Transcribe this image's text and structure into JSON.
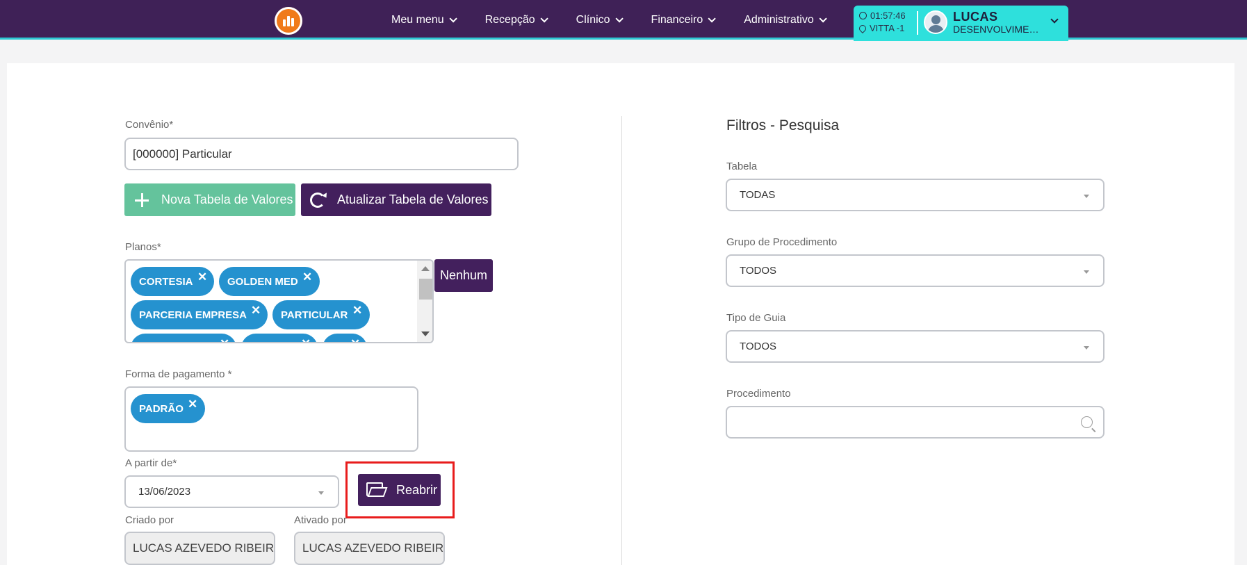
{
  "nav": {
    "items": [
      {
        "label": "Meu menu"
      },
      {
        "label": "Recepção"
      },
      {
        "label": "Clínico"
      },
      {
        "label": "Financeiro"
      },
      {
        "label": "Administrativo"
      }
    ]
  },
  "user": {
    "time": "01:57:46",
    "location": "VITTA -1",
    "name": "LUCAS",
    "role": "DESENVOLVIMENTO"
  },
  "form": {
    "convenio_label": "Convênio*",
    "convenio_value": "[000000] Particular",
    "new_table_button": "Nova Tabela de Valores",
    "update_table_button": "Atualizar Tabela de Valores",
    "planos_label": "Planos*",
    "planos": [
      "CORTESIA",
      "GOLDEN MED",
      "PARCERIA EMPRESA",
      "PARTICULAR"
    ],
    "none_button": "Nenhum",
    "payment_label": "Forma de pagamento *",
    "payment_methods": [
      "PADRÃO"
    ],
    "start_date_label": "A partir de*",
    "start_date_value": "13/06/2023",
    "reopen_button": "Reabrir",
    "created_by_label": "Criado por",
    "created_by_value": "LUCAS AZEVEDO RIBEIRO",
    "activated_by_label": "Ativado por",
    "activated_by_value": "LUCAS AZEVEDO RIBEIRO"
  },
  "filters": {
    "title": "Filtros - Pesquisa",
    "table_label": "Tabela",
    "table_value": "TODAS",
    "group_label": "Grupo de Procedimento",
    "group_value": "TODOS",
    "guide_label": "Tipo de Guia",
    "guide_value": "TODOS",
    "procedure_label": "Procedimento",
    "procedure_value": ""
  },
  "colors": {
    "nav_bg": "#3f2157",
    "accent_cyan": "#2ee0dc",
    "primary_purple": "#43205d",
    "success_green": "#64c39c",
    "chip_blue": "#2592cf",
    "highlight_red": "#e81c1c"
  }
}
